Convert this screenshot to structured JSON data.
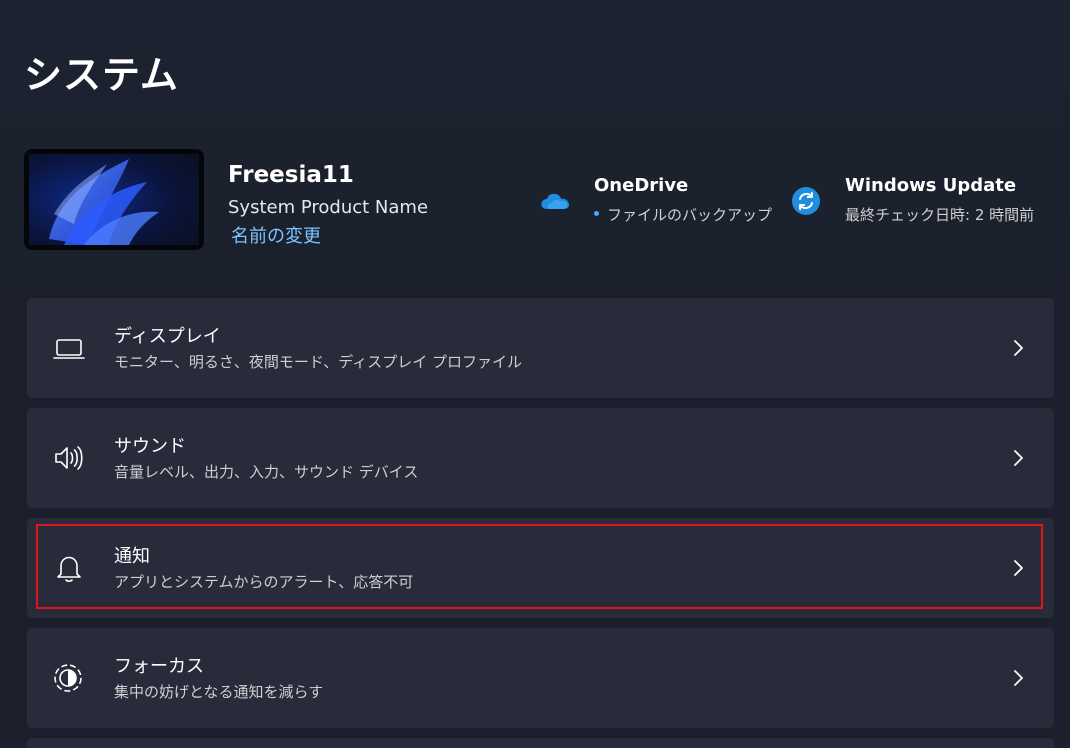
{
  "header": {
    "title": "システム"
  },
  "device": {
    "name": "Freesia11",
    "model": "System Product Name",
    "rename_link": "名前の変更"
  },
  "status": [
    {
      "title": "OneDrive",
      "subtitle": "ファイルのバックアップ",
      "icon": "cloud-icon",
      "color": "#1f8de0"
    },
    {
      "title": "Windows Update",
      "subtitle": "最終チェック日時: 2 時間前",
      "icon": "sync-icon",
      "color": "#1f8de0"
    }
  ],
  "settings": [
    {
      "title": "ディスプレイ",
      "subtitle": "モニター、明るさ、夜間モード、ディスプレイ プロファイル",
      "icon": "monitor-icon"
    },
    {
      "title": "サウンド",
      "subtitle": "音量レベル、出力、入力、サウンド デバイス",
      "icon": "speaker-icon"
    },
    {
      "title": "通知",
      "subtitle": "アプリとシステムからのアラート、応答不可",
      "icon": "bell-icon",
      "highlighted": true
    },
    {
      "title": "フォーカス",
      "subtitle": "集中の妨げとなる通知を減らす",
      "icon": "focus-icon"
    }
  ],
  "colors": {
    "background": "#1c2230",
    "card": "#272b3a",
    "accent_link": "#7cc4ff",
    "highlight_border": "#e0141b"
  }
}
